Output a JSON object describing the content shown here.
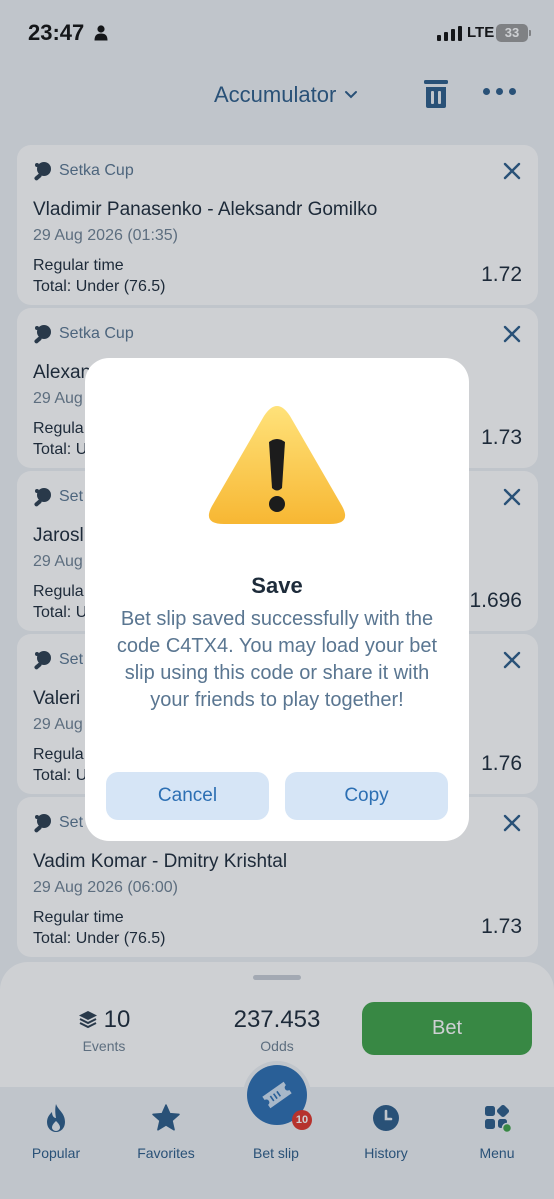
{
  "status_bar": {
    "time": "23:47",
    "network": "LTE",
    "battery": "33"
  },
  "header": {
    "title": "Accumulator"
  },
  "cards": [
    {
      "league": "Setka Cup",
      "teams": "Vladimir Panasenko - Aleksandr Gomilko",
      "date": "29 Aug 2026 (01:35)",
      "market": "Regular time",
      "outcome": "Total: Under (76.5)",
      "odds": "1.72"
    },
    {
      "league": "Setka Cup",
      "teams": "Alexan",
      "date": "29 Aug",
      "market": "Regula",
      "outcome": "Total: U",
      "odds": "1.73"
    },
    {
      "league": "Set",
      "teams": "Jarosl",
      "date": "29 Aug",
      "market": "Regula",
      "outcome": "Total: U",
      "odds": "1.696"
    },
    {
      "league": "Set",
      "teams": "Valeri",
      "date": "29 Aug",
      "market": "Regula",
      "outcome": "Total: U",
      "odds": "1.76"
    },
    {
      "league": "Set",
      "teams": "Vadim Komar - Dmitry Krishtal",
      "date": "29 Aug 2026 (06:00)",
      "market": "Regular time",
      "outcome": "Total: Under (76.5)",
      "odds": "1.73"
    }
  ],
  "summary": {
    "events_value": "10",
    "events_label": "Events",
    "odds_value": "237.453",
    "odds_label": "Odds",
    "bet_label": "Bet"
  },
  "tabbar": {
    "items": [
      {
        "label": "Popular"
      },
      {
        "label": "Favorites"
      },
      {
        "label": "Bet slip"
      },
      {
        "label": "History"
      },
      {
        "label": "Menu"
      }
    ],
    "betslip_badge": "10"
  },
  "dialog": {
    "title": "Save",
    "message": "Bet slip saved successfully with the code C4TX4. You may load your bet slip using this code or share it with your friends to play together!",
    "cancel_label": "Cancel",
    "copy_label": "Copy"
  },
  "colors": {
    "accent": "#2c6fb3",
    "bet_green": "#3fa348",
    "badge_red": "#e0352b"
  }
}
